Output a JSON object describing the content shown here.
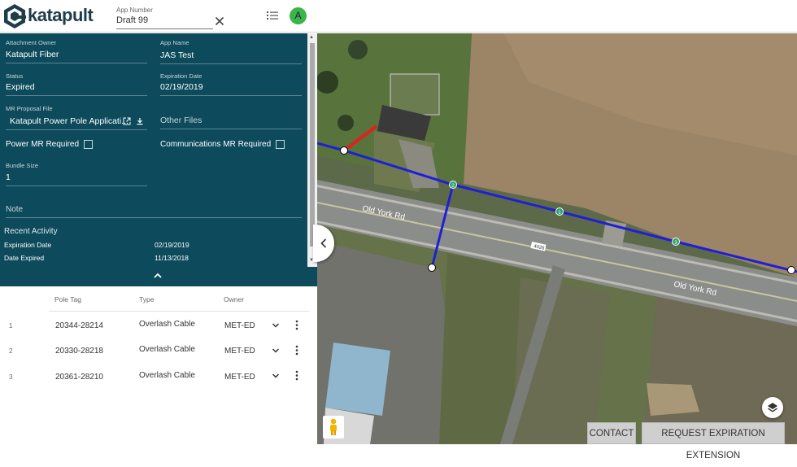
{
  "header": {
    "brand": "katapult",
    "app_number_label": "App Number",
    "app_number_value": "Draft 99",
    "avatar_letter": "A",
    "accent_color": "#3bb44a"
  },
  "details": {
    "attachment_owner_label": "Attachment Owner",
    "attachment_owner_value": "Katapult Fiber",
    "app_name_label": "App Name",
    "app_name_value": "JAS Test",
    "status_label": "Status",
    "status_value": "Expired",
    "expiration_date_label": "Expiration Date",
    "expiration_date_value": "02/19/2019",
    "mr_proposal_label": "MR Proposal File",
    "mr_proposal_value": "Katapult Power Pole Applicati...",
    "other_files_label": "Other Files",
    "power_mr_label": "Power MR Required",
    "comm_mr_label": "Communications MR Required",
    "power_mr_checked": false,
    "comm_mr_checked": false,
    "bundle_size_label": "Bundle Size",
    "bundle_size_value": "1",
    "note_label": "Note",
    "panel_color": "#0c4a5c"
  },
  "activity": {
    "title": "Recent Activity",
    "items": [
      {
        "label": "Expiration Date",
        "value": "02/19/2019"
      },
      {
        "label": "Date Expired",
        "value": "11/13/2018"
      }
    ]
  },
  "table": {
    "headers": [
      "Pole Tag",
      "Type",
      "Owner"
    ],
    "rows": [
      {
        "index": "1",
        "pole_tag": "20344-28214",
        "type": "Overlash Cable",
        "owner": "MET-ED"
      },
      {
        "index": "2",
        "pole_tag": "20330-28218",
        "type": "Overlash Cable",
        "owner": "MET-ED"
      },
      {
        "index": "3",
        "pole_tag": "20361-28210",
        "type": "Overlash Cable",
        "owner": "MET-ED"
      }
    ]
  },
  "map": {
    "road_label_1": "Old York Rd",
    "road_label_2": "Old York Rd",
    "road_shield": "4026",
    "pole_labels": [
      "2",
      "1",
      "3"
    ],
    "route_color": "#1f1fd6",
    "selected_color": "#e0211b",
    "contact_label": "CONTACT",
    "request_label": "REQUEST EXPIRATION EXTENSION"
  }
}
